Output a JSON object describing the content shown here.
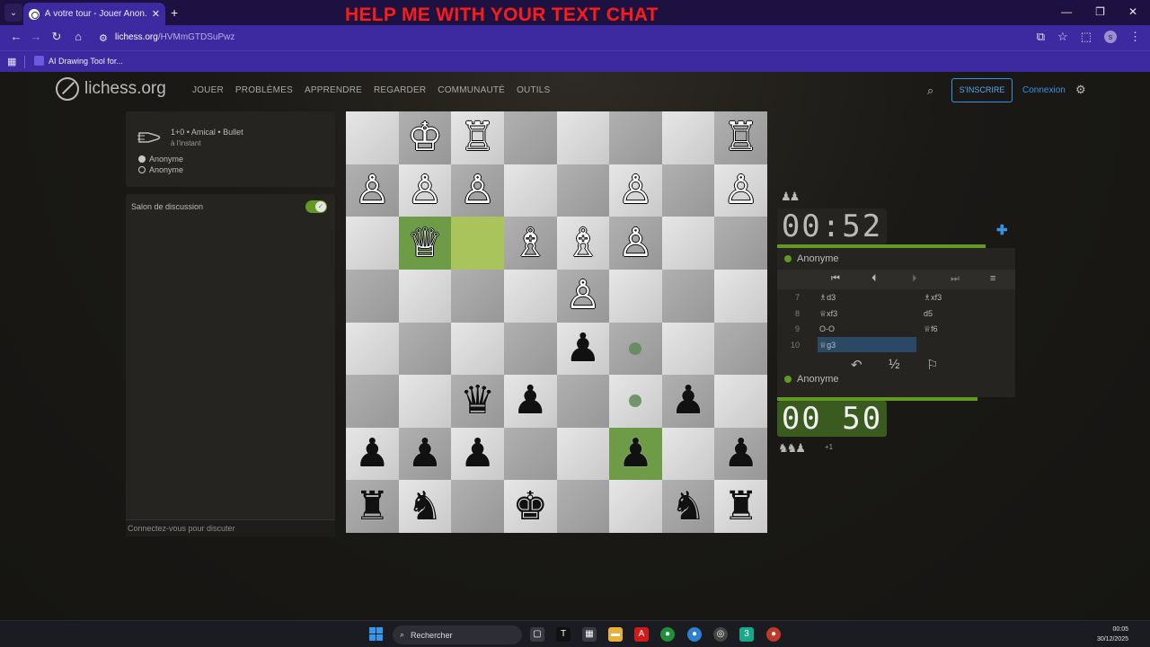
{
  "browser": {
    "tab_title": "À votre tour - Jouer Anon. • lic",
    "banner": "HELP ME WITH YOUR TEXT CHAT",
    "url_host": "lichess.org",
    "url_path": "/HVMmGTDSuPwz",
    "bookmark": "AI Drawing Tool for...",
    "profile_initial": "s"
  },
  "site": {
    "logo": "lichess.org",
    "nav": [
      "JOUER",
      "PROBLÈMES",
      "APPRENDRE",
      "REGARDER",
      "COMMUNAUTÉ",
      "OUTILS"
    ],
    "signup": "S'INSCRIRE",
    "login": "Connexion"
  },
  "game": {
    "title": "1+0 • Amical • Bullet",
    "subtitle": "à l'instant",
    "player1": "Anonyme",
    "player2": "Anonyme"
  },
  "chat": {
    "title": "Salon de discussion",
    "footer": "Connectez-vous pour discuter"
  },
  "board": {
    "orientation": "black",
    "pieces": [
      [
        "",
        "♔",
        "♖",
        "",
        "",
        "",
        "",
        "♖"
      ],
      [
        "♙",
        "♙",
        "♙",
        "",
        "",
        "♙",
        "",
        "♙"
      ],
      [
        "",
        "♕",
        "",
        "♗",
        "♗",
        "♙",
        "",
        ""
      ],
      [
        "",
        "",
        "",
        "",
        "♙",
        "",
        "",
        ""
      ],
      [
        "",
        "",
        "",
        "",
        "♟",
        "",
        "",
        ""
      ],
      [
        "",
        "",
        "♛",
        "♟",
        "",
        "",
        "♟",
        ""
      ],
      [
        "♟",
        "♟",
        "♟",
        "",
        "",
        "♟",
        "",
        "♟"
      ],
      [
        "♜",
        "♞",
        "",
        "♚",
        "",
        "",
        "♞",
        "♜"
      ]
    ],
    "highlights": [
      [
        2,
        1
      ],
      [
        2,
        2
      ],
      [
        6,
        5
      ]
    ],
    "move_dots": [
      [
        4,
        5
      ],
      [
        5,
        5
      ]
    ]
  },
  "clocks": {
    "top": "00:52",
    "bottom": "00 50",
    "top_player": "Anonyme",
    "bottom_player": "Anonyme",
    "material_top": "♟♟",
    "material_bottom": "♞♞♟",
    "material_bottom_extra": "+1"
  },
  "moves": [
    {
      "n": "7",
      "w": "♗d3",
      "b": "♗xf3"
    },
    {
      "n": "8",
      "w": "♕xf3",
      "b": "d5"
    },
    {
      "n": "9",
      "w": "O-O",
      "b": "♕f6"
    },
    {
      "n": "10",
      "w": "♕g3",
      "b": ""
    }
  ],
  "actions": {
    "draw": "½"
  },
  "taskbar": {
    "search": "Rechercher",
    "time": "00:05",
    "date": "30/12/2025"
  },
  "colors": {
    "accent": "#629924",
    "link": "#3692e7",
    "browser": "#3d2aa0",
    "banner": "#ff1a1a"
  }
}
